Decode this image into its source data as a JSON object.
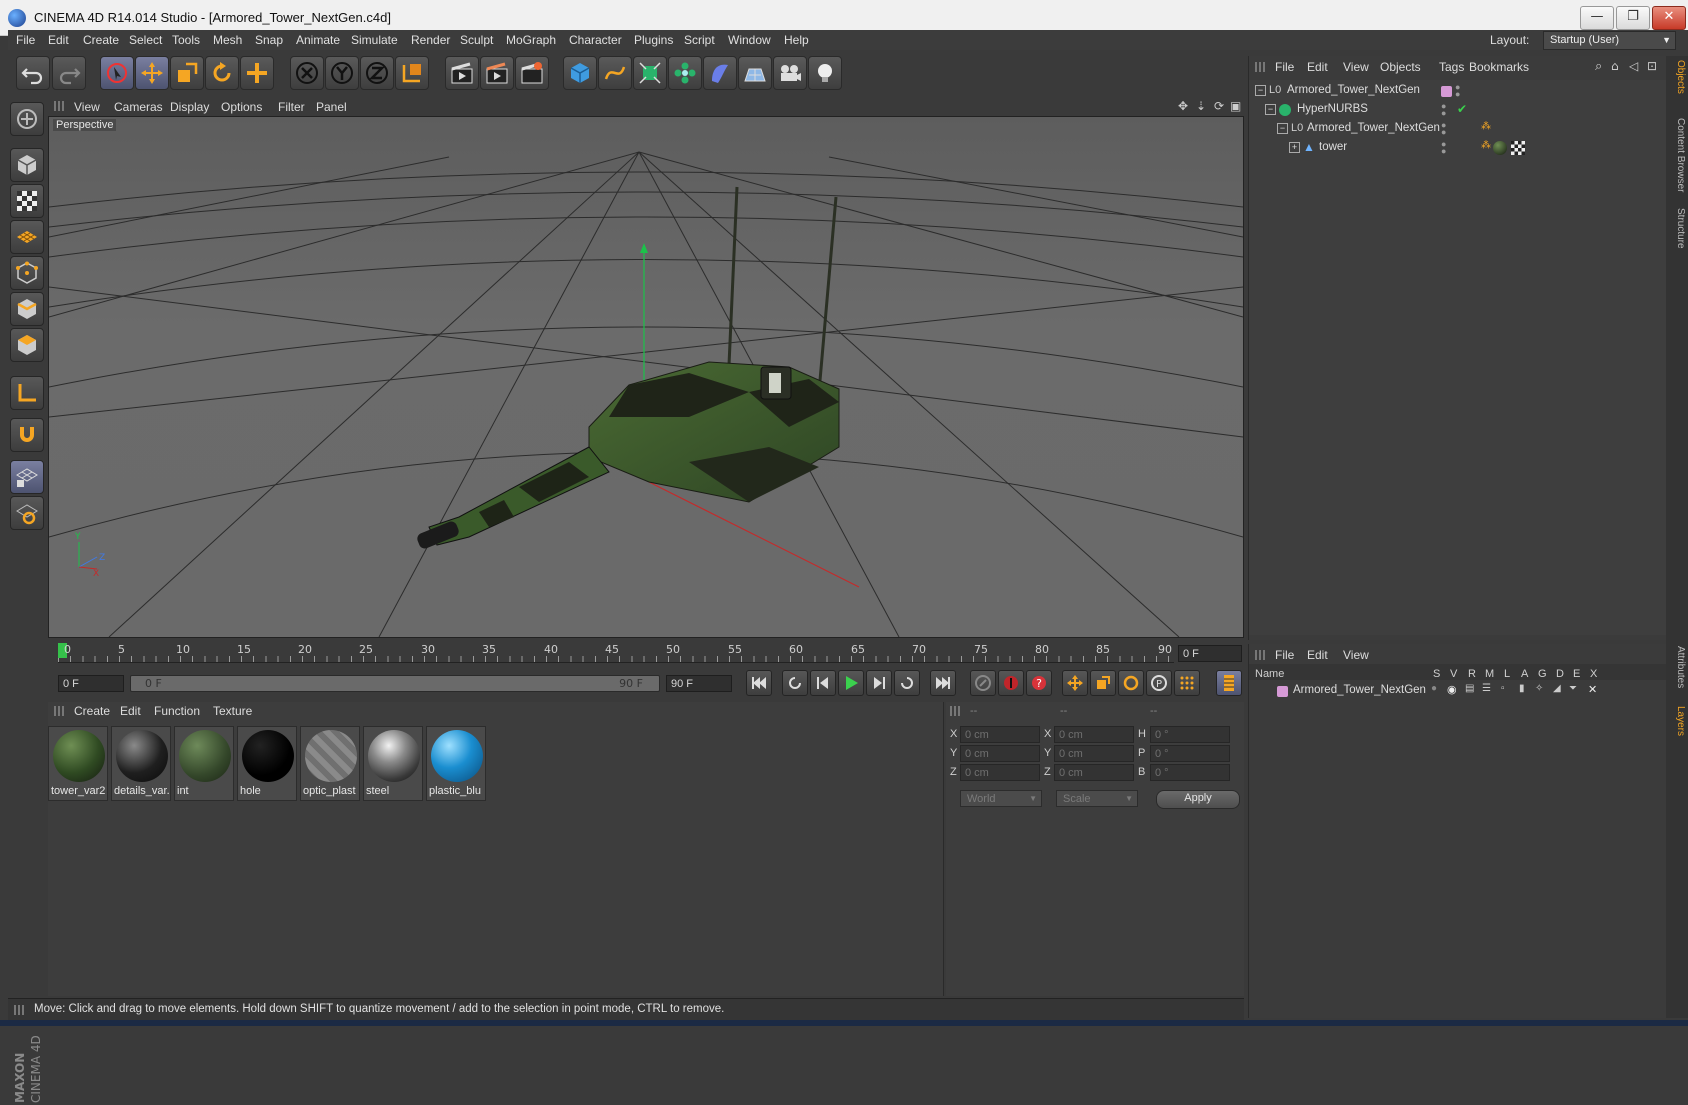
{
  "window": {
    "title": "CINEMA 4D R14.014 Studio - [Armored_Tower_NextGen.c4d]",
    "minimize": "—",
    "maximize": "❐",
    "close": "✕"
  },
  "menu": [
    "File",
    "Edit",
    "Create",
    "Select",
    "Tools",
    "Mesh",
    "Snap",
    "Animate",
    "Simulate",
    "Render",
    "Sculpt",
    "MoGraph",
    "Character",
    "Plugins",
    "Script",
    "Window",
    "Help"
  ],
  "layout": {
    "label": "Layout:",
    "value": "Startup (User)"
  },
  "viewport": {
    "menu": [
      "View",
      "Cameras",
      "Display",
      "Options",
      "Filter",
      "Panel"
    ],
    "label": "Perspective"
  },
  "timeline": {
    "ticks": [
      "0",
      "5",
      "10",
      "15",
      "20",
      "25",
      "30",
      "35",
      "40",
      "45",
      "50",
      "55",
      "60",
      "65",
      "70",
      "75",
      "80",
      "85",
      "90"
    ],
    "current_frame": "0 F"
  },
  "transport": {
    "start": "0 F",
    "range_start": "0 F",
    "range_end": "90 F",
    "end": "90 F"
  },
  "materials": {
    "menu": [
      "Create",
      "Edit",
      "Function",
      "Texture"
    ],
    "items": [
      {
        "name": "tower_var2"
      },
      {
        "name": "details_var."
      },
      {
        "name": "int"
      },
      {
        "name": "hole"
      },
      {
        "name": "optic_plast"
      },
      {
        "name": "steel"
      },
      {
        "name": "plastic_blu"
      }
    ]
  },
  "coords": {
    "headers": [
      "--",
      "--",
      "--"
    ],
    "rows": [
      {
        "a": "X",
        "av": "0 cm",
        "b": "X",
        "bv": "0 cm",
        "c": "H",
        "cv": "0 °"
      },
      {
        "a": "Y",
        "av": "0 cm",
        "b": "Y",
        "bv": "0 cm",
        "c": "P",
        "cv": "0 °"
      },
      {
        "a": "Z",
        "av": "0 cm",
        "b": "Z",
        "bv": "0 cm",
        "c": "B",
        "cv": "0 °"
      }
    ],
    "mode1": "World",
    "mode2": "Scale",
    "apply": "Apply"
  },
  "objects": {
    "menu": [
      "File",
      "Edit",
      "View",
      "Objects",
      "Tags",
      "Bookmarks"
    ],
    "tree": [
      {
        "name": "Armored_Tower_NextGen"
      },
      {
        "name": "HyperNURBS"
      },
      {
        "name": "Armored_Tower_NextGen"
      },
      {
        "name": "tower"
      }
    ]
  },
  "layers": {
    "menu": [
      "File",
      "Edit",
      "View"
    ],
    "columns": [
      "Name",
      "S",
      "V",
      "R",
      "M",
      "L",
      "A",
      "G",
      "D",
      "E",
      "X"
    ],
    "rows": [
      {
        "name": "Armored_Tower_NextGen"
      }
    ]
  },
  "side_tabs": [
    "Objects",
    "Content Browser",
    "Structure",
    "Attributes",
    "Layers"
  ],
  "brand": {
    "company": "MAXON",
    "product": "CINEMA 4D"
  },
  "status": "Move: Click and drag to move elements. Hold down SHIFT to quantize movement / add to the selection in point mode, CTRL to remove.",
  "colors": {
    "accent": "#8e94c4",
    "bg": "#3a3a3a",
    "viewport": "#666666",
    "camo_dark": "#1f2418",
    "camo_green": "#3e5a2c"
  }
}
